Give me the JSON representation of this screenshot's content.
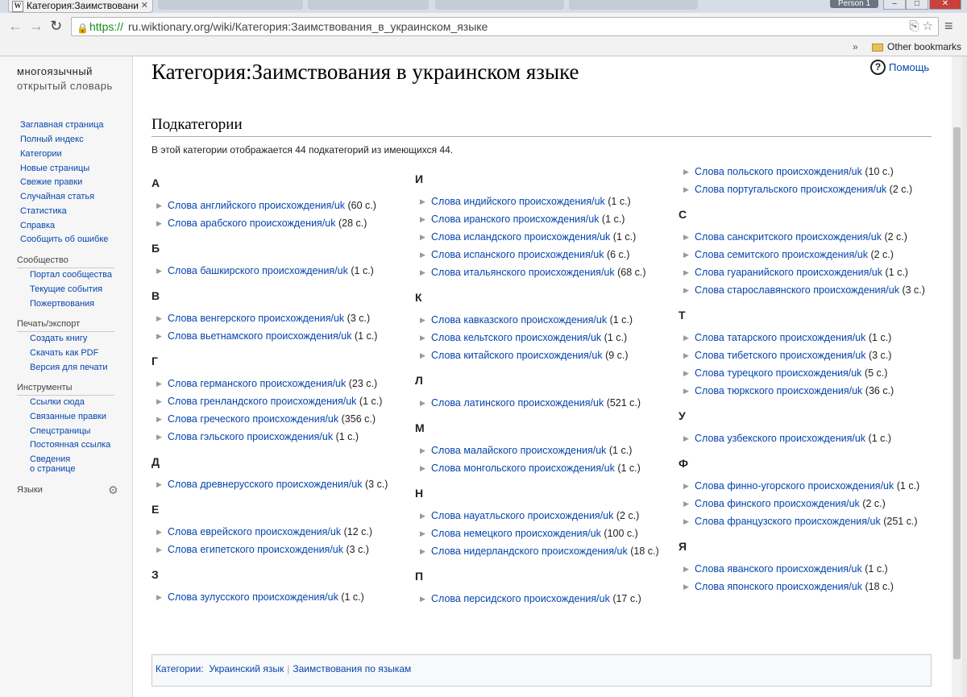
{
  "browser": {
    "active_tab_title": "Категория:Заимствовани",
    "tab_favicon": "W",
    "person": "Person 1",
    "url_scheme": "https://",
    "url_rest": "ru.wiktionary.org/wiki/Категория:Заимствования_в_украинском_языке",
    "bookmarks_overflow": "»",
    "bookmark_folder": "Other bookmarks"
  },
  "sidebar": {
    "logo_line1": "многоязычный",
    "logo_line2": "открытый словарь",
    "nav": [
      "Заглавная страница",
      "Полный индекс",
      "Категории",
      "Новые страницы",
      "Свежие правки",
      "Случайная статья",
      "Статистика",
      "Справка",
      "Сообщить об ошибке"
    ],
    "community": {
      "heading": "Сообщество",
      "items": [
        "Портал сообщества",
        "Текущие события",
        "Пожертвования"
      ]
    },
    "print": {
      "heading": "Печать/экспорт",
      "items": [
        "Создать книгу",
        "Скачать как PDF",
        "Версия для печати"
      ]
    },
    "tools": {
      "heading": "Инструменты",
      "items": [
        "Ссылки сюда",
        "Связанные правки",
        "Спецстраницы",
        "Постоянная ссылка",
        "Сведения",
        "о странице"
      ]
    },
    "languages_heading": "Языки"
  },
  "content": {
    "title": "Категория:Заимствования в украинском языке",
    "help_label": "Помощь",
    "subcategories_heading": "Подкатегории",
    "summary": "В этой категории отображается 44 подкатегорий из имеющихся 44.",
    "columns": [
      [
        {
          "letter": "А",
          "entries": [
            [
              "Слова английского происхождения/uk",
              "(60 с.)"
            ],
            [
              "Слова арабского происхождения/uk",
              "(28 с.)"
            ]
          ]
        },
        {
          "letter": "Б",
          "entries": [
            [
              "Слова башкирского происхождения/uk",
              "(1 с.)"
            ]
          ]
        },
        {
          "letter": "В",
          "entries": [
            [
              "Слова венгерского происхождения/uk",
              "(3 с.)"
            ],
            [
              "Слова вьетнамского происхождения/uk",
              "(1 с.)"
            ]
          ]
        },
        {
          "letter": "Г",
          "entries": [
            [
              "Слова германского происхождения/uk",
              "(23 с.)"
            ],
            [
              "Слова гренландского происхождения/uk",
              "(1 с.)"
            ],
            [
              "Слова греческого происхождения/uk",
              "(356 с.)"
            ],
            [
              "Слова гэльского происхождения/uk",
              "(1 с.)"
            ]
          ]
        },
        {
          "letter": "Д",
          "entries": [
            [
              "Слова древнерусского происхождения/uk",
              "(3 с.)"
            ]
          ]
        },
        {
          "letter": "Е",
          "entries": [
            [
              "Слова еврейского происхождения/uk",
              "(12 с.)"
            ],
            [
              "Слова египетского происхождения/uk",
              "(3 с.)"
            ]
          ]
        },
        {
          "letter": "З",
          "entries": [
            [
              "Слова зулусского происхождения/uk",
              "(1 с.)"
            ]
          ]
        }
      ],
      [
        {
          "letter": "И",
          "entries": [
            [
              "Слова индийского происхождения/uk",
              "(1 с.)"
            ],
            [
              "Слова иранского происхождения/uk",
              "(1 с.)"
            ],
            [
              "Слова исландского происхождения/uk",
              "(1 с.)"
            ],
            [
              "Слова испанского происхождения/uk",
              "(6 с.)"
            ],
            [
              "Слова итальянского происхождения/uk",
              "(68 с.)"
            ]
          ]
        },
        {
          "letter": "К",
          "entries": [
            [
              "Слова кавказского происхождения/uk",
              "(1 с.)"
            ],
            [
              "Слова кельтского происхождения/uk",
              "(1 с.)"
            ],
            [
              "Слова китайского происхождения/uk",
              "(9 с.)"
            ]
          ]
        },
        {
          "letter": "Л",
          "entries": [
            [
              "Слова латинского происхождения/uk",
              "(521 с.)"
            ]
          ]
        },
        {
          "letter": "М",
          "entries": [
            [
              "Слова малайского происхождения/uk",
              "(1 с.)"
            ],
            [
              "Слова монгольского происхождения/uk",
              "(1 с.)"
            ]
          ]
        },
        {
          "letter": "Н",
          "entries": [
            [
              "Слова науатльского происхождения/uk",
              "(2 с.)"
            ],
            [
              "Слова немецкого происхождения/uk",
              "(100 с.)"
            ],
            [
              "Слова нидерландского происхождения/uk",
              "(18 с.)"
            ]
          ]
        },
        {
          "letter": "П",
          "entries": [
            [
              "Слова персидского происхождения/uk",
              "(17 с.)"
            ]
          ]
        }
      ],
      [
        {
          "letter": "",
          "entries": [
            [
              "Слова польского происхождения/uk",
              "(10 с.)"
            ],
            [
              "Слова португальского происхождения/uk",
              "(2 с.)"
            ]
          ]
        },
        {
          "letter": "С",
          "entries": [
            [
              "Слова санскритского происхождения/uk",
              "(2 с.)"
            ],
            [
              "Слова семитского происхождения/uk",
              "(2 с.)"
            ],
            [
              "Слова гуаранийского происхождения/uk",
              "(1 с.)"
            ],
            [
              "Слова старославянского происхождения/uk",
              "(3 с.)"
            ]
          ]
        },
        {
          "letter": "Т",
          "entries": [
            [
              "Слова татарского происхождения/uk",
              "(1 с.)"
            ],
            [
              "Слова тибетского происхождения/uk",
              "(3 с.)"
            ],
            [
              "Слова турецкого происхождения/uk",
              "(5 с.)"
            ],
            [
              "Слова тюркского происхождения/uk",
              "(36 с.)"
            ]
          ]
        },
        {
          "letter": "У",
          "entries": [
            [
              "Слова узбекского происхождения/uk",
              "(1 с.)"
            ]
          ]
        },
        {
          "letter": "Ф",
          "entries": [
            [
              "Слова финно-угорского происхождения/uk",
              "(1 с.)"
            ],
            [
              "Слова финского происхождения/uk",
              "(2 с.)"
            ],
            [
              "Слова французского происхождения/uk",
              "(251 с.)"
            ]
          ]
        },
        {
          "letter": "Я",
          "entries": [
            [
              "Слова яванского происхождения/uk",
              "(1 с.)"
            ],
            [
              "Слова японского происхождения/uk",
              "(18 с.)"
            ]
          ]
        }
      ]
    ],
    "catlinks": {
      "label": "Категории:",
      "links": [
        "Украинский язык",
        "Заимствования по языкам"
      ]
    }
  }
}
